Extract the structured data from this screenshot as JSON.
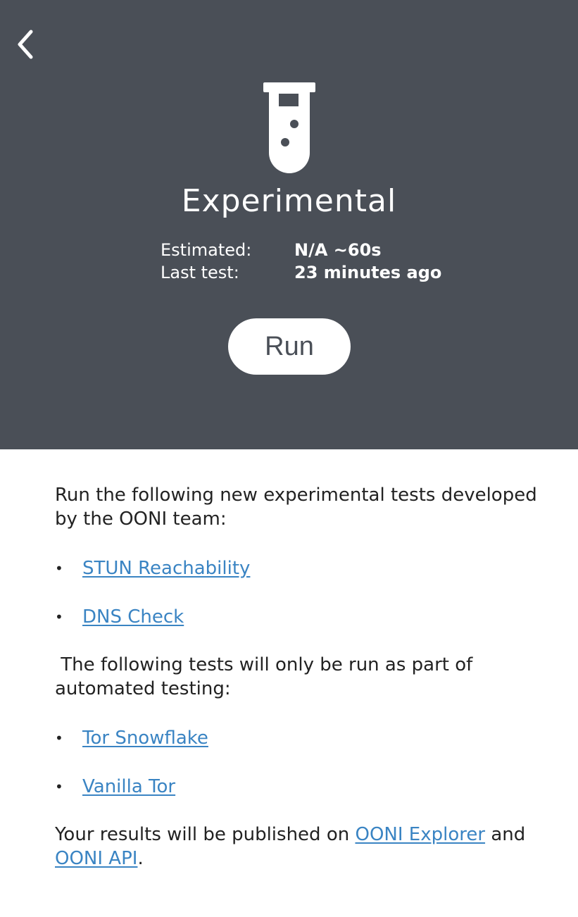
{
  "header": {
    "title": "Experimental",
    "back_icon": "chevron-left-icon",
    "test_icon": "flask-icon",
    "background_color": "#4a4f57",
    "estimated_label": "Estimated:",
    "estimated_value": "N/A ~60s",
    "last_test_label": "Last test:",
    "last_test_value": "23 minutes ago",
    "run_label": "Run"
  },
  "description": {
    "intro": "Run the following new experimental tests developed by the OONI team:",
    "experimental_tests": [
      {
        "label": "STUN Reachability"
      },
      {
        "label": "DNS Check"
      }
    ],
    "automated_intro": " The following tests will only be run as part of automated testing:",
    "automated_tests": [
      {
        "label": "Tor Snowflake"
      },
      {
        "label": "Vanilla Tor"
      }
    ],
    "publish_prefix": "Your results will be published on ",
    "publish_link_explorer": "OONI Explorer",
    "publish_middle": " and ",
    "publish_link_api": "OONI API",
    "publish_suffix": ".",
    "link_color": "#3a84c3"
  }
}
